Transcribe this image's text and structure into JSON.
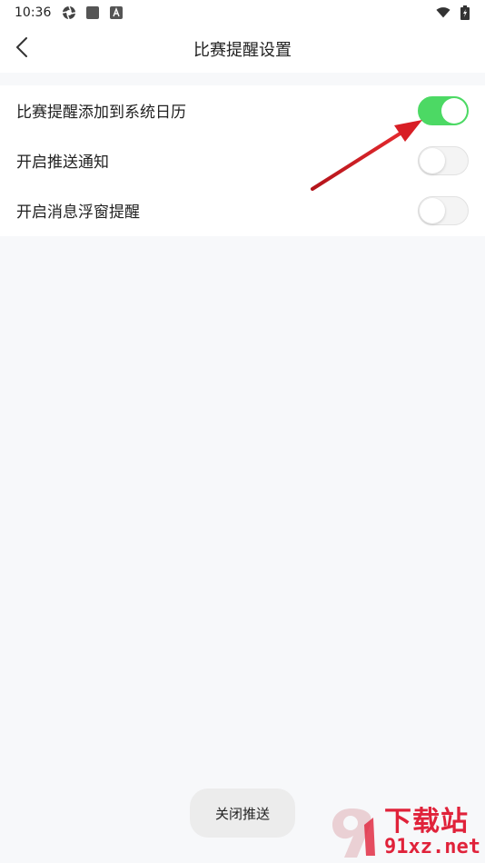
{
  "status_bar": {
    "time": "10:36",
    "icons_left": [
      "aperture-icon",
      "square-icon",
      "font-a-icon"
    ],
    "icons_right": [
      "wifi-icon",
      "battery-charging-icon"
    ]
  },
  "header": {
    "title": "比赛提醒设置",
    "back_icon": "chevron-left-icon"
  },
  "settings": [
    {
      "label": "比赛提醒添加到系统日历",
      "enabled": true
    },
    {
      "label": "开启推送通知",
      "enabled": false
    },
    {
      "label": "开启消息浮窗提醒",
      "enabled": false
    }
  ],
  "toast": {
    "text": "关闭推送"
  },
  "watermark": {
    "title": "下载站",
    "url": "91xz.net"
  },
  "colors": {
    "toggle_on": "#4cd964",
    "toggle_off": "#f4f4f4",
    "background": "#f7f8fa",
    "annotation": "#d81e25",
    "watermark": "#e0223a"
  }
}
